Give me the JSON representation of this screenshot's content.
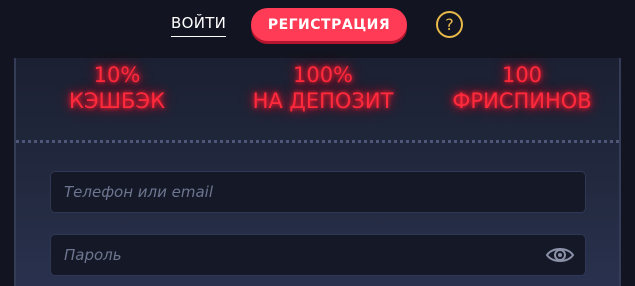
{
  "header": {
    "login_label": "ВОЙТИ",
    "register_label": "РЕГИСТРАЦИЯ",
    "help_label": "?"
  },
  "promos": [
    {
      "value": "10%",
      "label": "КЭШБЭК"
    },
    {
      "value": "100%",
      "label": "НА ДЕПОЗИТ"
    },
    {
      "value": "100",
      "label": "ФРИСПИНОВ"
    }
  ],
  "form": {
    "phone_placeholder": "Телефон или email",
    "password_placeholder": "Пароль",
    "password_toggle_icon": "eye-icon"
  },
  "colors": {
    "accent": "#ff3b56",
    "neon": "#ff2a3c",
    "help": "#e8b84a"
  }
}
